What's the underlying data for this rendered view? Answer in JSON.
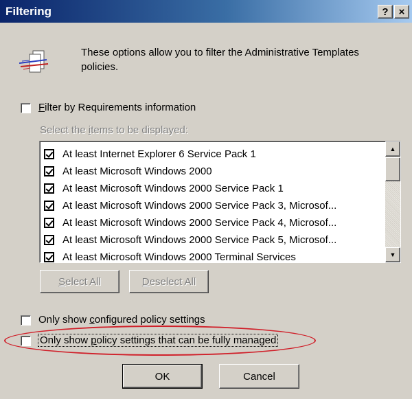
{
  "window": {
    "title": "Filtering",
    "help_glyph": "?",
    "close_glyph": "×"
  },
  "header": {
    "icon": "filter-templates-icon",
    "description": "These options allow you to filter the Administrative Templates policies."
  },
  "filter_by_requirements": {
    "checked": false,
    "label_mnemonic": "F",
    "label_rest": "ilter by Requirements information"
  },
  "select_items": {
    "label_pre": "Select the ",
    "label_mnemonic": "i",
    "label_post": "tems to be displayed:",
    "items": [
      {
        "label": "At least Internet Explorer 6 Service Pack 1",
        "checked": true
      },
      {
        "label": "At least Microsoft Windows 2000",
        "checked": true
      },
      {
        "label": "At least Microsoft Windows 2000 Service Pack 1",
        "checked": true
      },
      {
        "label": "At least Microsoft Windows 2000 Service Pack 3, Microsof...",
        "checked": true
      },
      {
        "label": "At least Microsoft Windows 2000 Service Pack 4, Microsof...",
        "checked": true
      },
      {
        "label": "At least Microsoft Windows 2000 Service Pack 5, Microsof...",
        "checked": true
      },
      {
        "label": "At least Microsoft Windows 2000 Terminal Services",
        "checked": true
      }
    ]
  },
  "buttons": {
    "select_all": {
      "mnemonic": "S",
      "rest": "elect All"
    },
    "deselect_all": {
      "mnemonic": "D",
      "rest": "eselect All"
    },
    "ok": "OK",
    "cancel": "Cancel"
  },
  "options": {
    "configured_only": {
      "pre": "Only show ",
      "mnemonic": "c",
      "post": "onfigured policy settings",
      "checked": false
    },
    "fully_managed": {
      "pre": "Only show ",
      "mnemonic": "p",
      "post": "olicy settings that can be fully managed",
      "checked": false
    }
  },
  "colors": {
    "dialog_face": "#d4d0c8",
    "title_gradient_start": "#0a246a",
    "title_gradient_end": "#a6caf0",
    "annotation_ellipse": "#d0202a"
  }
}
